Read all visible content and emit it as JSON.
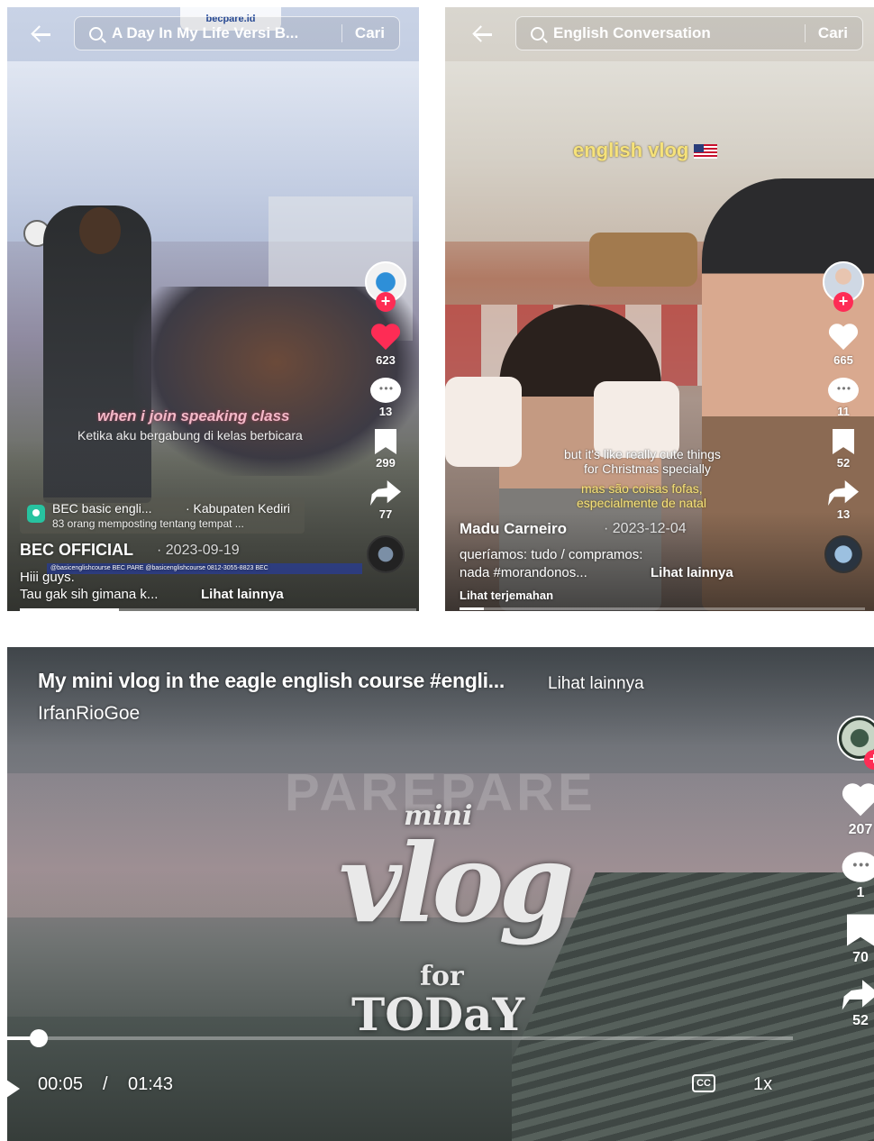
{
  "panel1": {
    "search_query": "A Day In My Life Versi B...",
    "search_button": "Cari",
    "banner_logo": "becpare.id",
    "likes": "623",
    "comments": "13",
    "saves": "299",
    "shares": "77",
    "caption_main": "when i join speaking class",
    "caption_sub": "Ketika aku bergabung di kelas berbicara",
    "location_name": "BEC basic engli...",
    "location_city": "· Kabupaten Kediri",
    "location_sub": "83 orang memposting tentang tempat ...",
    "author": "BEC OFFICIAL",
    "date": "· 2023-09-19",
    "contact_strip": "@basicenglishcourse  BEC PARE  @basicenglishcourse  0812-3055-8823  BEC",
    "desc_line1": "Hiii guys.",
    "desc_line2": "Tau gak sih gimana k...",
    "see_more": "Lihat lainnya",
    "progress_pct": 25
  },
  "panel2": {
    "search_query": "English Conversation",
    "search_button": "Cari",
    "vlog_label": "english vlog",
    "likes": "665",
    "comments": "11",
    "saves": "52",
    "shares": "13",
    "sub_en_1": "but it's like really cute things",
    "sub_en_2": "for Christmas specially",
    "sub_pt_1": "mas são coisas fofas,",
    "sub_pt_2": "especialmente de natal",
    "author": "Madu Carneiro",
    "date": "· 2023-12-04",
    "desc_line1": "queríamos: tudo / compramos:",
    "desc_line2": "nada #morandonos...",
    "see_more": "Lihat lainnya",
    "translate": "Lihat terjemahan",
    "progress_pct": 6
  },
  "panel3": {
    "title": "My mini vlog in the eagle english course #engli...",
    "see_more": "Lihat lainnya",
    "author": "IrfanRioGoe",
    "overlay_mini": "mini",
    "overlay_vlog": "vlog",
    "overlay_for": "for",
    "overlay_today": "TODaY",
    "likes": "207",
    "comments": "1",
    "saves": "70",
    "shares": "52",
    "time_current": "00:05",
    "time_sep": "/",
    "time_total": "01:43",
    "cc_label": "CC",
    "speed": "1x",
    "progress_pct": 4
  },
  "watermark": {
    "text": "PAREPARE"
  },
  "colors": {
    "like_active": "#fe2c55",
    "follow": "#fe2c55",
    "caption_yellow": "#f6e27a",
    "caption_pink": "#f3b9c8"
  }
}
